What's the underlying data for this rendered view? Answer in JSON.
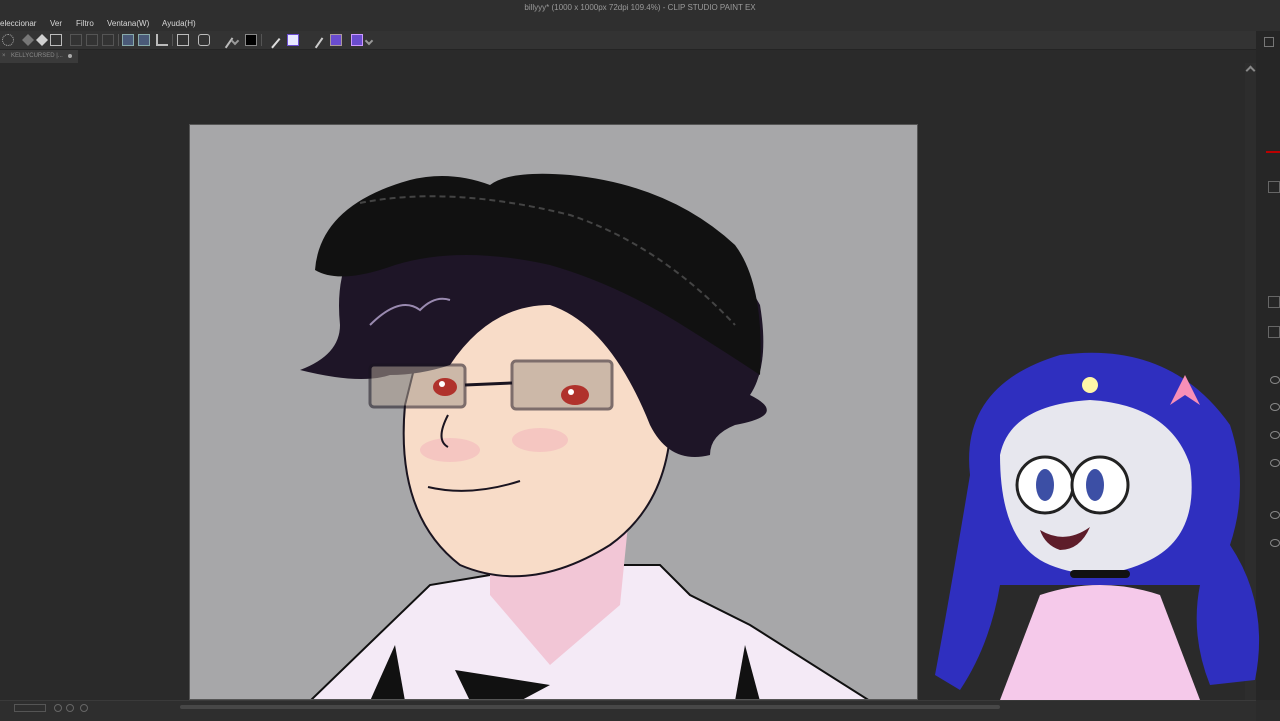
{
  "window": {
    "title": "billyyy* (1000 x 1000px 72dpi 109.4%)  - CLIP STUDIO PAINT EX"
  },
  "menu": {
    "items": [
      "eleccionar",
      "Ver",
      "Filtro",
      "Ventana(W)",
      "Ayuda(H)"
    ]
  },
  "toolbar": {
    "icons": [
      "select-all-icon",
      "move-icon",
      "crop-icon",
      "transform-icon",
      "blend-icon",
      "paste-icon",
      "pen-check-icon",
      "pen-alt-icon",
      "ruler-icon",
      "layer-icon",
      "lasso-icon",
      "pen-tool-icon",
      "color-swatch-icon",
      "eraser-icon",
      "fill-icon",
      "pencil-icon",
      "brush-icon",
      "brush-purple-icon"
    ]
  },
  "document_tab": {
    "name": "KELLYCURSED |..."
  },
  "colors": {
    "accent": "#6a4ccf",
    "canvas_bg": "#a7a7a9",
    "hair": "#1e1527",
    "hat": "#111111",
    "skin": "#f8dcc8"
  }
}
